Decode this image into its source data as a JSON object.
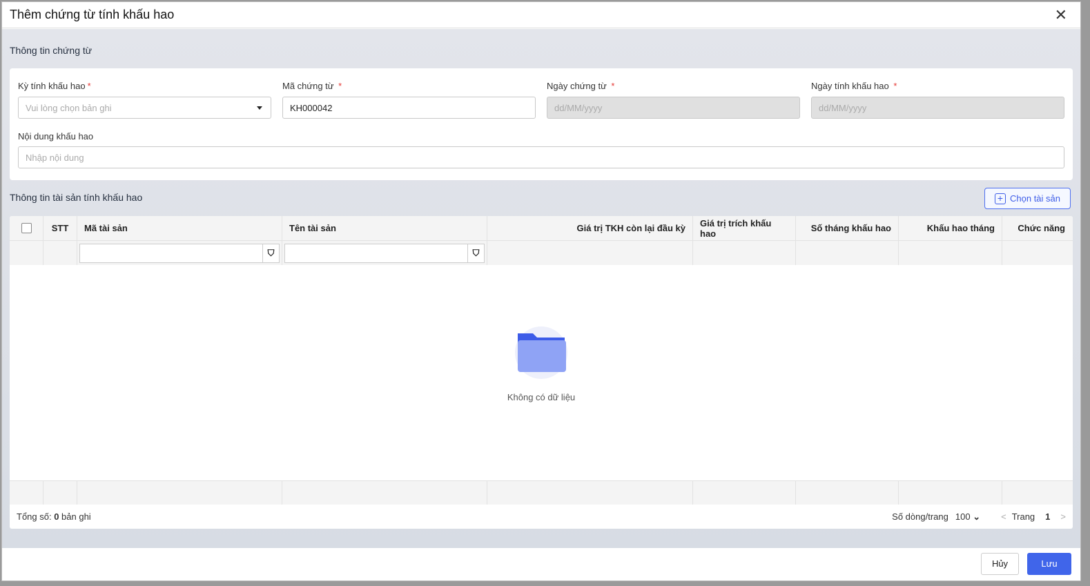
{
  "dialog": {
    "title": "Thêm chứng từ tính khấu hao"
  },
  "voucher": {
    "section_title": "Thông tin chứng từ",
    "period_label": "Kỳ tính khấu hao",
    "period_placeholder": "Vui lòng chọn bản ghi",
    "code_label": "Mã chứng từ",
    "code_value": "KH000042",
    "date_label": "Ngày chứng từ",
    "date_placeholder": "dd/MM/yyyy",
    "dep_date_label": "Ngày tính khấu hao",
    "dep_date_placeholder": "dd/MM/yyyy",
    "content_label": "Nội dung khấu hao",
    "content_placeholder": "Nhập nội dung",
    "required": "*"
  },
  "assets": {
    "section_title": "Thông tin tài sản tính khấu hao",
    "choose_label": "Chọn tài sản",
    "columns": [
      "STT",
      "Mã tài sản",
      "Tên tài sản",
      "Giá trị TKH còn lại đầu kỳ",
      "Giá trị trích khấu hao",
      "Số tháng khấu hao",
      "Khấu hao tháng",
      "Chức năng"
    ],
    "empty_text": "Không có dữ liệu",
    "total_prefix": "Tổng số: ",
    "total_count": "0",
    "total_suffix": " bản ghi",
    "page_size_label": "Số dòng/trang",
    "page_size": "100",
    "page_label": "Trang",
    "page": "1"
  },
  "footer": {
    "cancel": "Hủy",
    "save": "Lưu"
  },
  "colors": {
    "primary": "#4065ea"
  }
}
